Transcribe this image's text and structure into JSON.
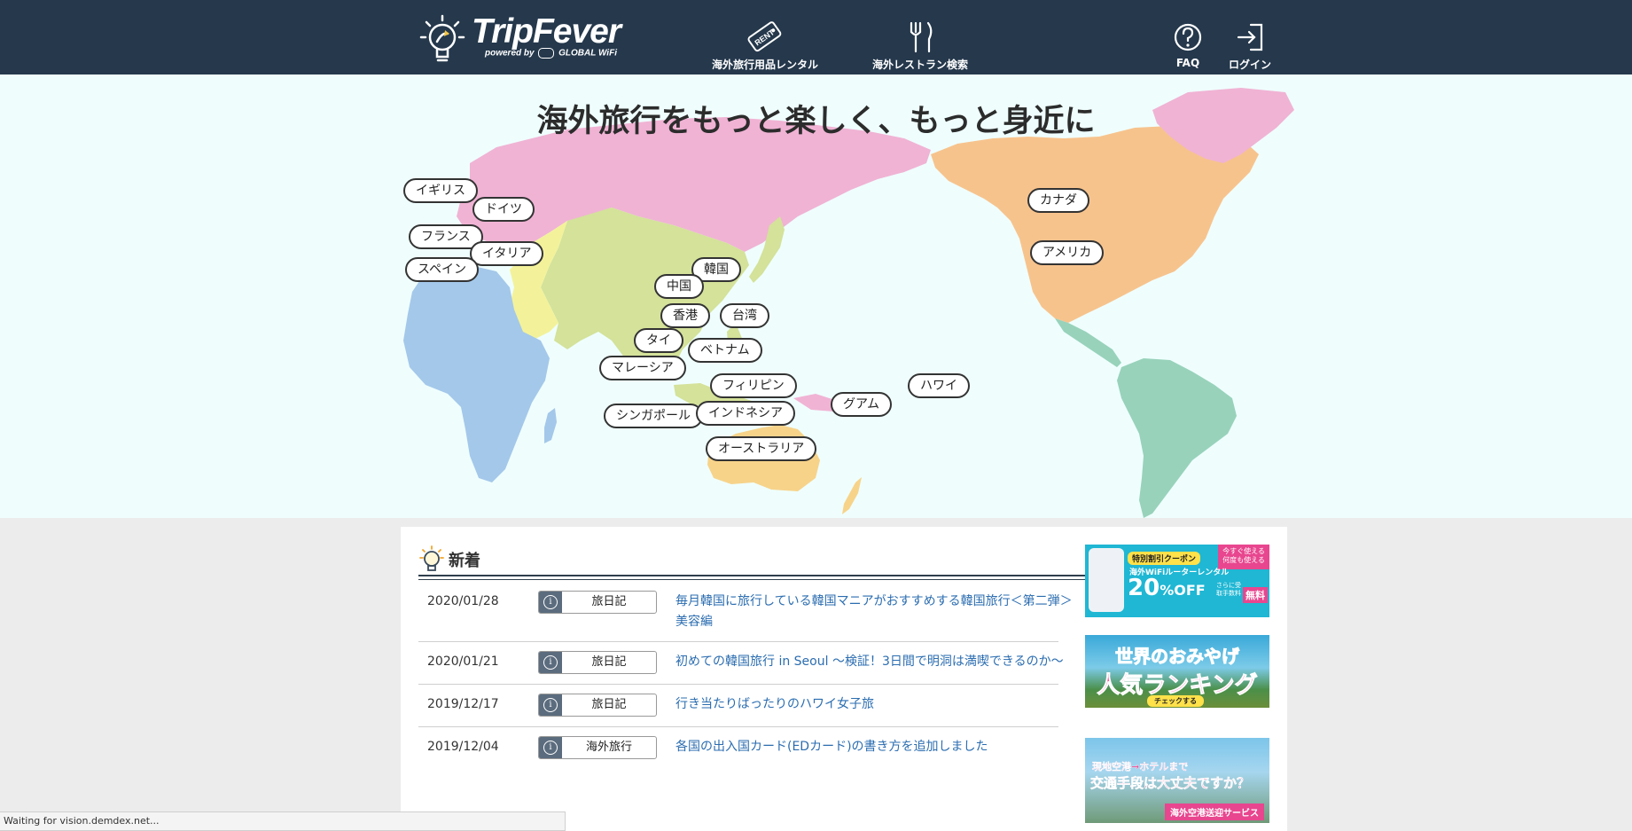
{
  "header": {
    "logo_title": "TripFever",
    "logo_sub_prefix": "powered by",
    "logo_sub_brand": "GLOBAL WiFi",
    "nav": [
      {
        "label": "海外旅行用品レンタル",
        "icon": "rent-tag-icon"
      },
      {
        "label": "海外レストラン検索",
        "icon": "fork-knife-icon"
      }
    ],
    "faq_label": "FAQ",
    "login_label": "ログイン",
    "rent_icon_text": "RENT"
  },
  "hero": {
    "title": "海外旅行をもっと楽しく、もっと身近に",
    "countries": [
      "イギリス",
      "ドイツ",
      "フランス",
      "イタリア",
      "スペイン",
      "カナダ",
      "アメリカ",
      "韓国",
      "中国",
      "香港",
      "台湾",
      "タイ",
      "ベトナム",
      "マレーシア",
      "フィリピン",
      "ハワイ",
      "グアム",
      "シンガポール",
      "インドネシア",
      "オーストラリア"
    ]
  },
  "news": {
    "heading": "新着",
    "items": [
      {
        "date": "2020/01/28",
        "tag": "旅日記",
        "title": "毎月韓国に旅行している韓国マニアがおすすめする韓国旅行＜第二弾＞美容編"
      },
      {
        "date": "2020/01/21",
        "tag": "旅日記",
        "title": "初めての韓国旅行 in Seoul 〜検証！3日間で明洞は満喫できるのか〜"
      },
      {
        "date": "2019/12/17",
        "tag": "旅日記",
        "title": "行き当たりばったりのハワイ女子旅"
      },
      {
        "date": "2019/12/04",
        "tag": "海外旅行",
        "title": "各国の出入国カード(EDカード)の書き方を追加しました"
      }
    ]
  },
  "banners": {
    "coupon": {
      "badge": "特別割引クーポン",
      "corner": "今すぐ使える何度も使える",
      "line": "海外WiFiルーターレンタル",
      "percent": "20",
      "off": "%OFF",
      "extra": "さらに受取手数料",
      "free": "無料"
    },
    "souvenir": {
      "line1": "世界のおみやげ",
      "line2": "人気ランキング",
      "cta": "チェックする"
    },
    "transfer": {
      "line1": "現地空港→ホテルまで",
      "line2": "交通手段は大丈夫ですか？",
      "cta": "海外空港送迎サービス"
    }
  },
  "status_text": "Waiting for vision.demdex.net...",
  "colors": {
    "header_bg": "#25384c",
    "hero_bg": "#effefd",
    "eurasia": "#f0b3d4",
    "asia": "#d4e29a",
    "middle_east": "#f3f29a",
    "africa": "#a4c8ea",
    "north_america": "#f7c38d",
    "south_america": "#98d2bb",
    "oceania": "#f7d38a",
    "link": "#2b6db0"
  }
}
